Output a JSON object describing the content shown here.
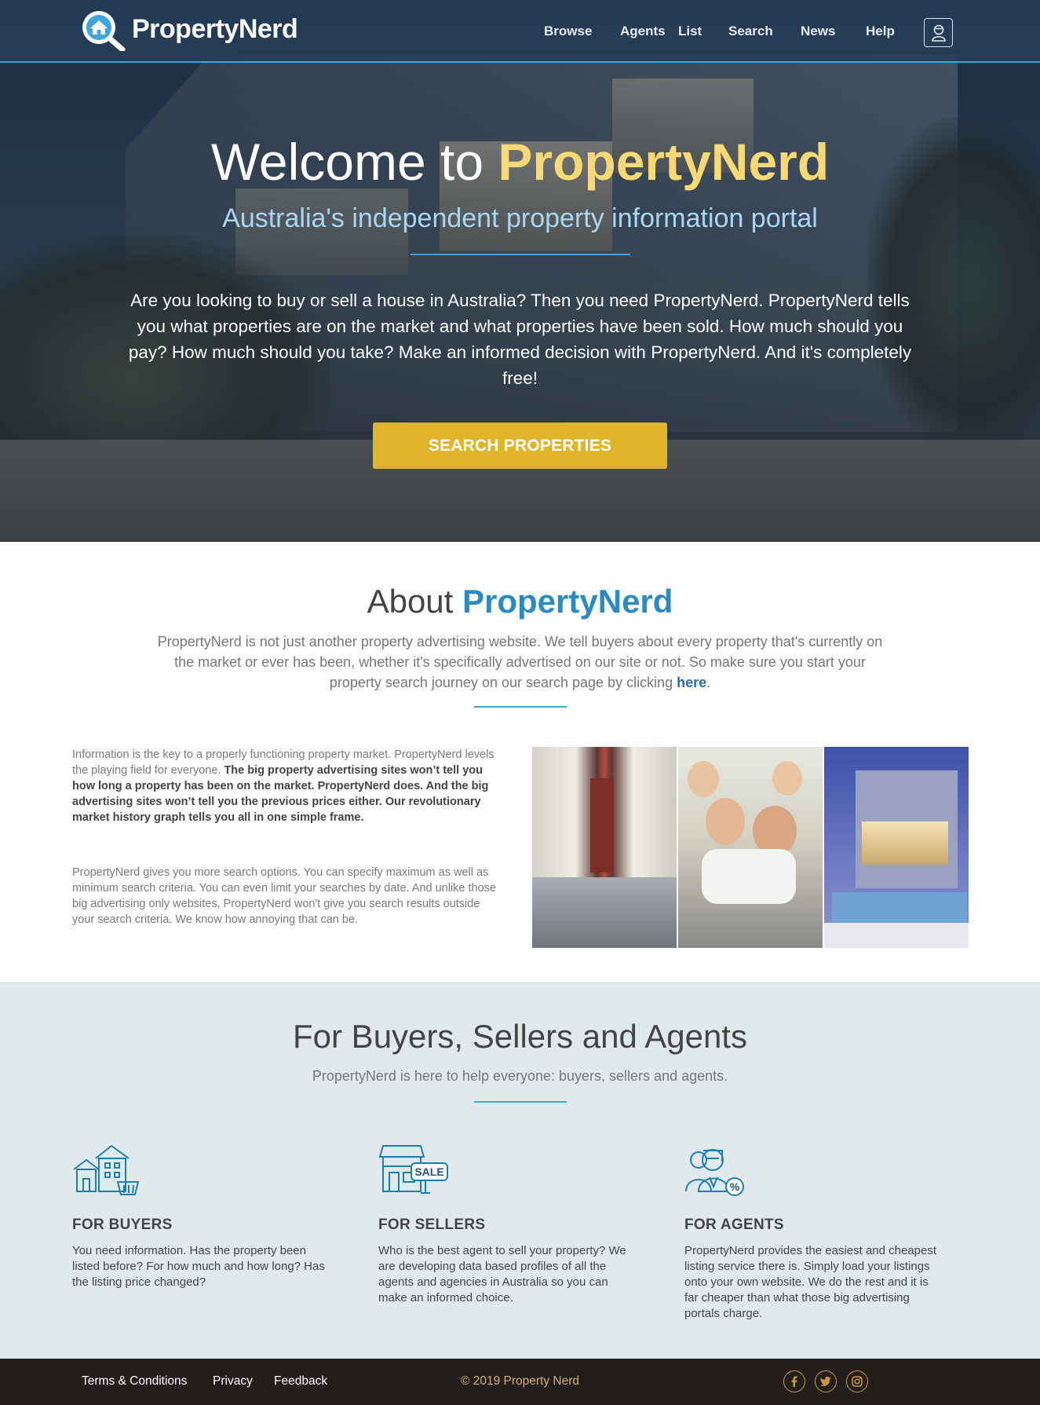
{
  "nav": {
    "brand": "PropertyNerd",
    "links": [
      "Browse",
      "Agents",
      "List",
      "Search",
      "News",
      "Help"
    ]
  },
  "hero": {
    "title_prefix": "Welcome to ",
    "title_brand": "PropertyNerd",
    "subtitle": "Australia's independent property information portal",
    "description": "Are you looking to buy or sell a house in Australia? Then you need PropertyNerd. PropertyNerd tells you what properties are on the market and what properties have been sold. How much should you pay? How much should you take? Make an informed decision with PropertyNerd. And it's completely free!",
    "cta": "SEARCH PROPERTIES"
  },
  "about": {
    "title_prefix": "About ",
    "title_brand": "PropertyNerd",
    "desc": "PropertyNerd is not just another property advertising website. We tell buyers about every property that's currently on the market or ever has been, whether it's specifically advertised on our site or not. So make sure you start your property search journey on our search page by clicking ",
    "desc_link": "here",
    "desc_end": ".",
    "p1_normal": "Information is the key to a properly functioning property market. PropertyNerd levels the playing field for everyone. ",
    "p1_bold": "The big property advertising sites won’t tell you how long a property has been on the market. PropertyNerd does. And the big advertising sites won’t tell you the previous prices either. Our revolutionary market history graph tells you all in one simple frame.",
    "p2": "PropertyNerd gives you more search options. You can specify maximum as well as minimum search criteria. You can even limit your searches by date. And unlike those big advertising only websites, PropertyNerd won't give you search results outside your search criteria. We know how annoying that can be."
  },
  "audiences": {
    "title": "For Buyers, Sellers and Agents",
    "subtitle": "PropertyNerd is here to help everyone: buyers, sellers and agents.",
    "buyers": {
      "heading": "FOR BUYERS",
      "text": "You need information. Has the property been listed before? For how much and how long? Has the listing price changed?"
    },
    "sellers": {
      "heading": "FOR SELLERS",
      "sign": "SALE",
      "text": "Who is the best agent to sell your property? We are developing data based profiles of all the agents and agencies in Australia so you can make an informed choice."
    },
    "agents": {
      "heading": "FOR AGENTS",
      "badge": "%",
      "text": "PropertyNerd provides the easiest and cheapest listing service there is. Simply load your listings onto your own website. We do the rest and it is far cheaper than what those big advertising portals charge."
    }
  },
  "footer": {
    "links": [
      "Terms & Conditions",
      "Privacy",
      "Feedback"
    ],
    "copyright": "© 2019 Property Nerd",
    "social_icons": [
      "facebook-icon",
      "twitter-icon",
      "instagram-icon"
    ]
  },
  "colors": {
    "accent_blue": "#3fa5dc",
    "brand_blue": "#2b8ac2",
    "brand_yellow": "#f8d976",
    "cta_gold": "#e2b42a",
    "footer_bg": "#231e1b"
  }
}
